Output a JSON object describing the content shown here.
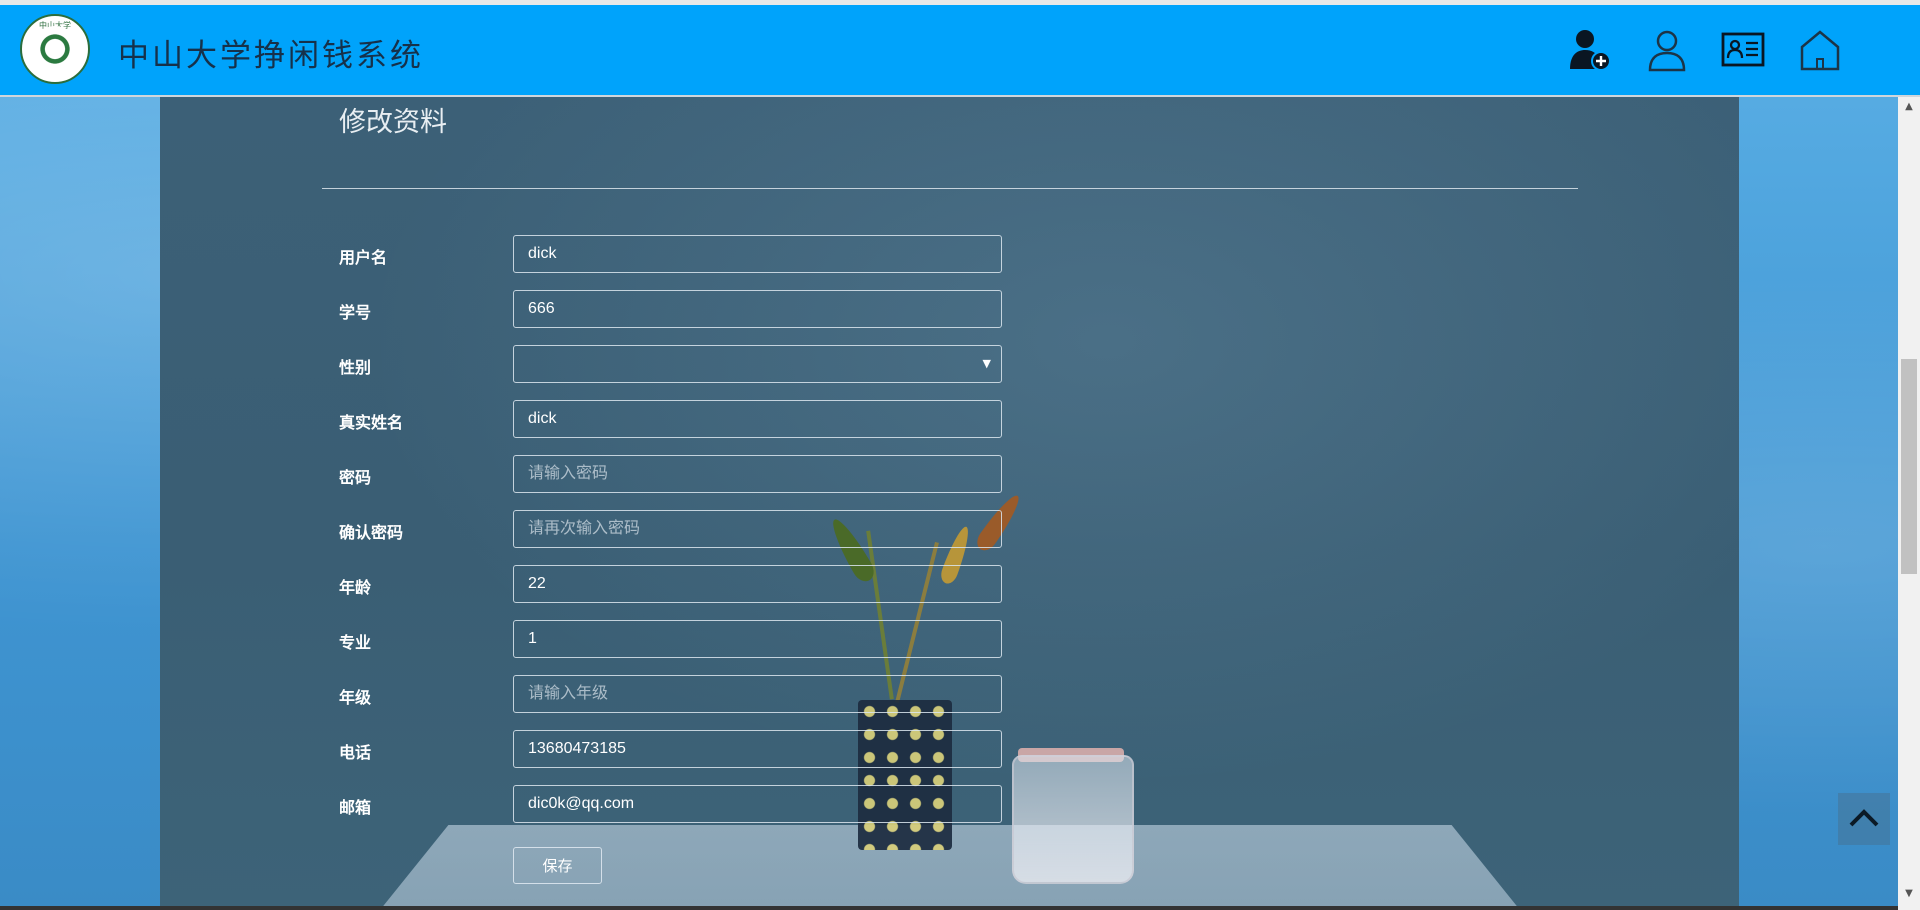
{
  "header": {
    "logo_text": "中山大学",
    "site_title": "中山大学挣闲钱系统",
    "nav": [
      {
        "name": "register-user-icon"
      },
      {
        "name": "user-icon"
      },
      {
        "name": "profile-card-icon"
      },
      {
        "name": "home-icon"
      }
    ],
    "bg_color": "#00a3fb"
  },
  "form": {
    "title": "修改资料",
    "fields": [
      {
        "label": "用户名",
        "value": "dick",
        "placeholder": ""
      },
      {
        "label": "学号",
        "value": "666",
        "placeholder": ""
      },
      {
        "label": "性别",
        "value": "",
        "placeholder": ""
      },
      {
        "label": "真实姓名",
        "value": "dick",
        "placeholder": ""
      },
      {
        "label": "密码",
        "value": "",
        "placeholder": "请输入密码"
      },
      {
        "label": "确认密码",
        "value": "",
        "placeholder": "请再次输入密码"
      },
      {
        "label": "年龄",
        "value": "22",
        "placeholder": ""
      },
      {
        "label": "专业",
        "value": "1",
        "placeholder": ""
      },
      {
        "label": "年级",
        "value": "",
        "placeholder": "请输入年级"
      },
      {
        "label": "电话",
        "value": "13680473185",
        "placeholder": ""
      },
      {
        "label": "邮箱",
        "value": "dic0k@qq.com",
        "placeholder": ""
      }
    ],
    "save_label": "保存"
  },
  "scrollbar": {
    "up_arrow": "▲",
    "down_arrow": "▼"
  },
  "select_arrow": "▼"
}
